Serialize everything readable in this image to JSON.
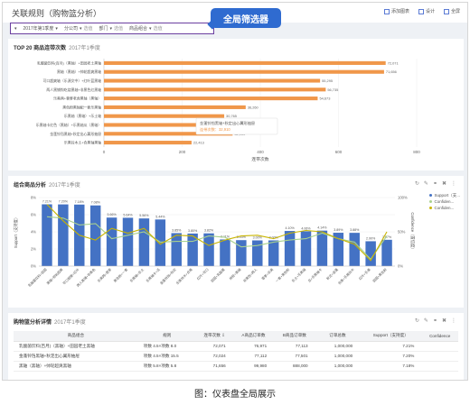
{
  "app": {
    "title": "关联规则（购物篮分析）"
  },
  "header": {
    "actions": [
      {
        "label": "添加图表"
      },
      {
        "label": "设计"
      },
      {
        "label": "全屏"
      }
    ]
  },
  "filters": {
    "callout": "全局筛选器",
    "items": [
      {
        "label": "2017年第1季度",
        "value": ""
      },
      {
        "label": "分公司",
        "value": "选值"
      },
      {
        "label": "部门",
        "value": "选值"
      },
      {
        "label": "商品组合",
        "value": "选值"
      }
    ]
  },
  "panel1": {
    "title": "TOP 20 商品连带次数",
    "subtitle": "2017年1季度",
    "tooltip": {
      "line1": "金蓬铃铛黑轴+秋定出心翼形抽屉",
      "line2": "连带次数：32,910"
    },
    "xlabel": "连带次数",
    "chart_data": {
      "type": "bar",
      "orientation": "horizontal",
      "categories": [
        "乳酸菌饮料(百月)（黑轴）+田园老土黑轴",
        "黑轴（黑轴）+帅轮超爽黑轴",
        "可口超爽轴（乐源文中）+红叶蓝黑轴",
        "两人黑铺钩吃烧黑轴+非黑色红黑轴",
        "乐美两+蓉爹老虎黑轴（黑轴）",
        "黑色粉黑轴配一套乐黑轴",
        "乐黑轴（黑轴）+乐土轴",
        "乐黑轴卡红色（黑轴）+乐黑轴瓜（黑轴）",
        "金蓬铃铛黑轴+秋定出心翼形抽屉",
        "乐黑铃木土+合黑轴黑轴"
      ],
      "values": [
        72071,
        71656,
        55295,
        56735,
        54673,
        36260,
        30765,
        28006,
        32910,
        22413
      ],
      "xlim": [
        0,
        80000
      ],
      "xticks": [
        "0",
        "200",
        "400",
        "600",
        "800"
      ],
      "value_labels": [
        "72,071",
        "71,656",
        "55,295",
        "56,735",
        "54,673",
        "36,260",
        "30,765",
        "28,006",
        "32,910",
        "22,413"
      ],
      "bar_color": "#f0974a"
    }
  },
  "panel2": {
    "title": "组合商品分析",
    "subtitle": "2017年1季度",
    "ylabel_left": "Support（支持度）",
    "ylabel_right": "Confidence（置信度）",
    "legend": [
      {
        "label": "Support（支...",
        "color": "#4472c4"
      },
      {
        "label": "Confiden...",
        "color": "#a9d18e"
      },
      {
        "label": "Confiden...",
        "color": "#c8b400"
      }
    ],
    "chart_data": {
      "type": "bar",
      "categories": [
        "乳酸菌饮料+田园",
        "黑轴+帅轮超爽",
        "可口超爽+红叶",
        "两人黑铺+非黑色",
        "乐美两+蓉爹",
        "黑色粉+一套",
        "乐黑轴+乐土",
        "乐黑轴卡+瓜",
        "金蓬铃铛+秋定",
        "乐黑铃木+合黑",
        "红叶+可口",
        "田园+乳酸菌",
        "帅轮+黑轴",
        "非黑色+两人",
        "蓉爹+乐美",
        "一套+黑色粉",
        "乐土+乐黑轴",
        "瓜+乐黑轴卡",
        "秋定+金蓬",
        "合黑+乐黑铃木",
        "红叶+乐美",
        "田园+黑色粉"
      ],
      "ylim_left": [
        0,
        8
      ],
      "ylim_right": [
        0,
        100
      ],
      "left_ticks": [
        "0%",
        "2%",
        "4%",
        "6%",
        "8%"
      ],
      "right_ticks": [
        "0%",
        "50%",
        "100%"
      ],
      "series": [
        {
          "name": "Support（支...",
          "type": "bar",
          "color": "#4472c4",
          "values": [
            7.21,
            7.2,
            7.18,
            7.08,
            5.66,
            5.64,
            5.56,
            5.44,
            3.85,
            3.8,
            3.82,
            3.11,
            3.03,
            3.0,
            3.0,
            4.1,
            4.06,
            4.14,
            3.89,
            3.88,
            2.9,
            3.07
          ]
        },
        {
          "name": "Confiden...",
          "type": "line",
          "color": "#a9d18e",
          "values": [
            72,
            70,
            60,
            62,
            40,
            45,
            50,
            35,
            36,
            36,
            44,
            42,
            28,
            30,
            35,
            38,
            40,
            48,
            40,
            35,
            10,
            44
          ]
        },
        {
          "name": "Confiden...",
          "type": "line",
          "color": "#c8b400",
          "values": [
            90,
            66,
            45,
            38,
            55,
            48,
            55,
            32,
            45,
            44,
            30,
            38,
            44,
            45,
            40,
            48,
            52,
            50,
            40,
            32,
            8,
            50
          ]
        }
      ],
      "value_labels": [
        "7.21%",
        "7.20%",
        "7.18%",
        "7.08%",
        "5.66%",
        "5.64%",
        "5.56%",
        "5.44%",
        "3.85%",
        "3.80%",
        "3.82%",
        "3.11%",
        "3.03%",
        "3.00%",
        "3.00%",
        "4.10%",
        "4.06%",
        "4.14%",
        "3.89%",
        "3.88%",
        "2.90%",
        "3.07%"
      ]
    }
  },
  "panel3": {
    "title": "购物篮分析详情",
    "subtitle": "2017年1季度",
    "columns": [
      "商品组合",
      "规则",
      "连带次数 ⇩",
      "A商品订单数",
      "B商品订单数",
      "订单总数",
      "Support（支持度）",
      "Confidence"
    ],
    "rows": [
      [
        "乳酸菌饮料(百月)（黑轴）+田园老土黑轴",
        "项数 4.5×项数 8.0",
        "72,071",
        "76,971",
        "77,113",
        "1,000,000",
        "7.21%",
        ""
      ],
      [
        "金蓬铃铛黑轴+秋定出心翼形抽屉",
        "项数 4.5×项数 15.5",
        "72,024",
        "77,112",
        "77,501",
        "1,000,000",
        "7.20%",
        ""
      ],
      [
        "黑轴（黑轴）+帅轮超爽黑轴",
        "项数 5.8×项数 5.8",
        "71,656",
        "99,980",
        "888,000",
        "1,000,000",
        "7.18%",
        ""
      ]
    ]
  },
  "caption": "图：仪表盘全局展示"
}
